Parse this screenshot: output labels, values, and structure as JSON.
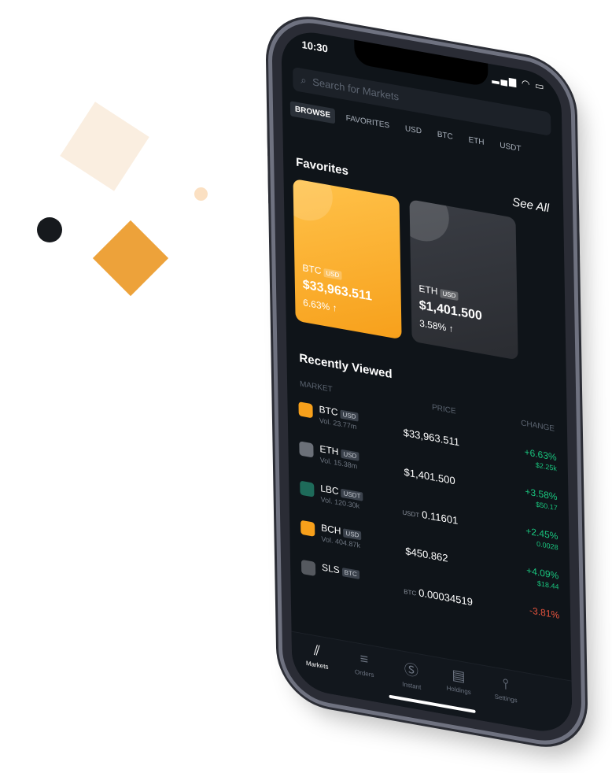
{
  "status": {
    "time": "10:30",
    "icons": "▂▄▆ ◠ ▭"
  },
  "search": {
    "icon": "search-icon",
    "placeholder": "Search for Markets"
  },
  "tabs": [
    "BROWSE",
    "FAVORITES",
    "USD",
    "BTC",
    "ETH",
    "USDT"
  ],
  "favorites": {
    "title": "Favorites",
    "see_all": "See All",
    "cards": [
      {
        "symbol": "BTC",
        "quote": "USD",
        "price": "$33,963.511",
        "change": "6.63% ↑"
      },
      {
        "symbol": "ETH",
        "quote": "USD",
        "price": "$1,401.500",
        "change": "3.58% ↑"
      }
    ]
  },
  "recent": {
    "title": "Recently Viewed",
    "cols": {
      "market": "MARKET",
      "price": "PRICE",
      "change": "CHANGE"
    },
    "rows": [
      {
        "symbol": "BTC",
        "quote": "USD",
        "vol": "Vol. 23.77m",
        "price_prefix": "",
        "price": "$33,963.511",
        "change": "+6.63%",
        "change_abs": "$2.25k",
        "color": "#19c37d",
        "icon_color": "#f7a01b"
      },
      {
        "symbol": "ETH",
        "quote": "USD",
        "vol": "Vol. 15.38m",
        "price_prefix": "",
        "price": "$1,401.500",
        "change": "+3.58%",
        "change_abs": "$50.17",
        "color": "#19c37d",
        "icon_color": "#6b7078"
      },
      {
        "symbol": "LBC",
        "quote": "USDT",
        "vol": "Vol. 120.30k",
        "price_prefix": "USDT",
        "price": "0.11601",
        "change": "+2.45%",
        "change_abs": "0.0028",
        "color": "#19c37d",
        "icon_color": "#1e6b5a"
      },
      {
        "symbol": "BCH",
        "quote": "USD",
        "vol": "Vol. 404.87k",
        "price_prefix": "",
        "price": "$450.862",
        "change": "+4.09%",
        "change_abs": "$18.44",
        "color": "#19c37d",
        "icon_color": "#f7a01b"
      },
      {
        "symbol": "SLS",
        "quote": "BTC",
        "vol": "",
        "price_prefix": "BTC",
        "price": "0.00034519",
        "change": "-3.81%",
        "change_abs": "",
        "color": "#e5533d",
        "icon_color": "#55595f"
      }
    ]
  },
  "tabbar": [
    {
      "label": "Markets",
      "icon": "chart-icon",
      "active": true
    },
    {
      "label": "Orders",
      "icon": "orders-icon",
      "active": false
    },
    {
      "label": "Instant",
      "icon": "dollar-icon",
      "active": false
    },
    {
      "label": "Holdings",
      "icon": "wallet-icon",
      "active": false
    },
    {
      "label": "Settings",
      "icon": "sliders-icon",
      "active": false
    }
  ]
}
